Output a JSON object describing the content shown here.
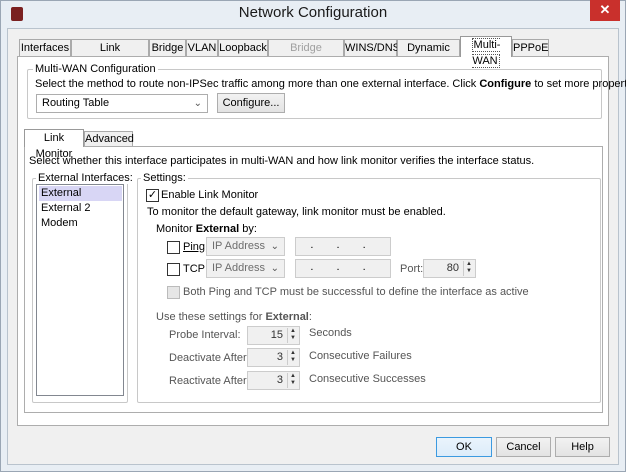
{
  "window": {
    "title": "Network Configuration",
    "close": "✕"
  },
  "tabs": [
    {
      "label": "Interfaces",
      "disabled": false
    },
    {
      "label": "Link Aggregation"
    },
    {
      "label": "Bridge"
    },
    {
      "label": "VLAN"
    },
    {
      "label": "Loopback"
    },
    {
      "label": "Bridge Protocols",
      "disabled": true
    },
    {
      "label": "WINS/DNS"
    },
    {
      "label": "Dynamic DNS"
    },
    {
      "label": "Multi-WAN",
      "selected": true
    },
    {
      "label": "PPPoE"
    }
  ],
  "multiwan": {
    "group_label": "Multi-WAN Configuration",
    "description": "Select the method to route non-IPSec traffic among more than one external interface. Click ",
    "desc_bold": "Configure",
    "desc_end": " to set more properties.",
    "method": "Routing Table",
    "configure_button": "Configure..."
  },
  "subtabs": {
    "link_monitor": "Link Monitor",
    "advanced": "Advanced"
  },
  "link_monitor": {
    "description": "Select whether this interface participates in multi-WAN and how link monitor verifies the interface status.",
    "interfaces_label": "External Interfaces:",
    "interfaces": [
      "External",
      "External 2",
      "Modem"
    ],
    "selected_interface": "External",
    "settings_label": "Settings:",
    "enable_label": "Enable Link Monitor",
    "enable_checked": true,
    "gateway_note": "To monitor the default gateway, link monitor must be enabled.",
    "monitor_by_prefix": "Monitor ",
    "monitor_by_iface": "External",
    "monitor_by_suffix": " by:",
    "ping": {
      "label": "Ping",
      "checked": false,
      "type": "IP Address",
      "address": ". . ."
    },
    "tcp": {
      "label": "TCP",
      "checked": false,
      "type": "IP Address",
      "address": ". . .",
      "port_label": "Port:",
      "port": "80"
    },
    "both_label": "Both Ping and TCP must be successful to define the interface as active",
    "use_settings_prefix": "Use these settings for ",
    "use_settings_iface": "External",
    ":": ":",
    "probe": {
      "label": "Probe Interval:",
      "value": "15",
      "unit": "Seconds"
    },
    "deactivate": {
      "label": "Deactivate After:",
      "value": "3",
      "unit": "Consecutive Failures"
    },
    "reactivate": {
      "label": "Reactivate After:",
      "value": "3",
      "unit": "Consecutive Successes"
    }
  },
  "buttons": {
    "ok": "OK",
    "cancel": "Cancel",
    "help": "Help"
  }
}
